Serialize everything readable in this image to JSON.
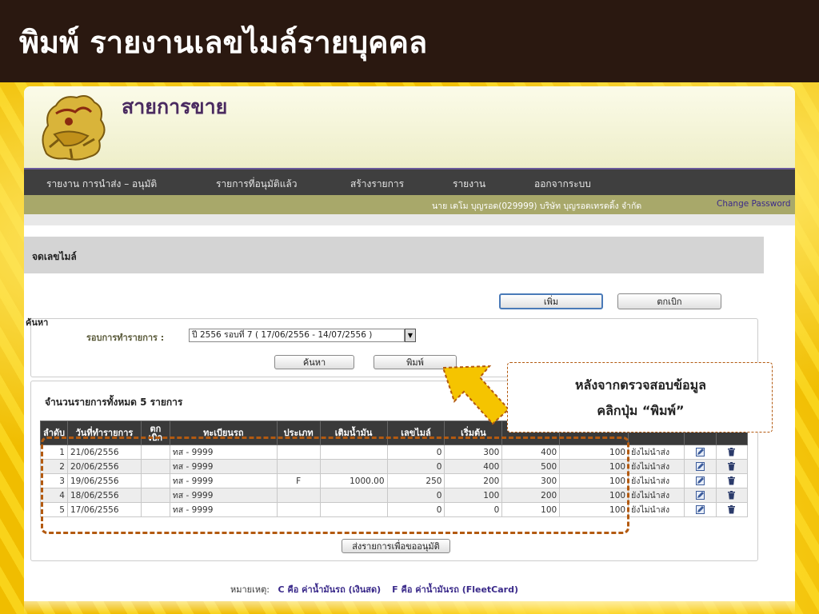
{
  "slide": {
    "title": "พิมพ์ รายงานเลขไมล์รายบุคคล"
  },
  "app": {
    "title": "สายการขาย",
    "logo_icon": "garuda-lion-emblem-icon"
  },
  "nav": {
    "items": [
      {
        "label": "รายงาน การนำส่ง – อนุมัติ"
      },
      {
        "label": "รายการที่อนุมัติแล้ว"
      },
      {
        "label": "สร้างรายการ"
      },
      {
        "label": "รายงาน"
      },
      {
        "label": "ออกจากระบบ"
      }
    ]
  },
  "user_bar": {
    "user": "นาย เดโม บุญรอด(029999) บริษัท บุญรอดเทรดดิ้ง จำกัด",
    "change_password": "Change Password"
  },
  "section": {
    "title": "จดเลขไมล์"
  },
  "buttons": {
    "add": "เพิ่ม",
    "cancel": "ตกเบิก",
    "search": "ค้นหา",
    "print": "พิมพ์",
    "submit": "ส่งรายการเพื่อขออนุมัติ"
  },
  "search": {
    "label": "ค้นหา",
    "period_label": "รอบการทำรายการ :",
    "period_value": "ปี 2556 รอบที่ 7 ( 17/06/2556 - 14/07/2556 )"
  },
  "list": {
    "total_label": "จำนวนรายการทั้งหมด 5 รายการ",
    "headers": [
      "ลำดับ",
      "วันที่ทำรายการ",
      "ตก เบิก",
      "ทะเบียนรถ",
      "ประเภท",
      "เติมน้ำมัน",
      "เลขไมล์",
      "เริ่มต้น",
      "",
      "",
      "",
      "",
      ""
    ],
    "rows": [
      {
        "no": "1",
        "date": "21/06/2556",
        "cancel": "",
        "plate": "ทส - 9999",
        "type": "",
        "fuel": "",
        "mile": "0",
        "start": "300",
        "end": "400",
        "dist": "100",
        "status": "ยังไม่นำส่ง"
      },
      {
        "no": "2",
        "date": "20/06/2556",
        "cancel": "",
        "plate": "ทส - 9999",
        "type": "",
        "fuel": "",
        "mile": "0",
        "start": "400",
        "end": "500",
        "dist": "100",
        "status": "ยังไม่นำส่ง"
      },
      {
        "no": "3",
        "date": "19/06/2556",
        "cancel": "",
        "plate": "ทส - 9999",
        "type": "F",
        "fuel": "1000.00",
        "mile": "250",
        "start": "200",
        "end": "300",
        "dist": "100",
        "status": "ยังไม่นำส่ง"
      },
      {
        "no": "4",
        "date": "18/06/2556",
        "cancel": "",
        "plate": "ทส - 9999",
        "type": "",
        "fuel": "",
        "mile": "0",
        "start": "100",
        "end": "200",
        "dist": "100",
        "status": "ยังไม่นำส่ง"
      },
      {
        "no": "5",
        "date": "17/06/2556",
        "cancel": "",
        "plate": "ทส - 9999",
        "type": "",
        "fuel": "",
        "mile": "0",
        "start": "0",
        "end": "100",
        "dist": "100",
        "status": "ยังไม่นำส่ง"
      }
    ]
  },
  "note": {
    "prefix": "หมายเหตุ:",
    "c_text": "C คือ ค่าน้ำมันรถ (เงินสด)",
    "f_text": "F คือ ค่าน้ำมันรถ (FleetCard)"
  },
  "callout": {
    "line1": "หลังจากตรวจสอบข้อมูล",
    "line2": "คลิกปุ่ม “พิมพ์”"
  },
  "colors": {
    "slide_header": "#2a1810",
    "slide_bg": "#f3c400",
    "nav_bg": "#3f3f3f",
    "user_bar_bg": "#a8a86a",
    "highlight": "#b35a10",
    "arrow_fill": "#f5c400"
  }
}
